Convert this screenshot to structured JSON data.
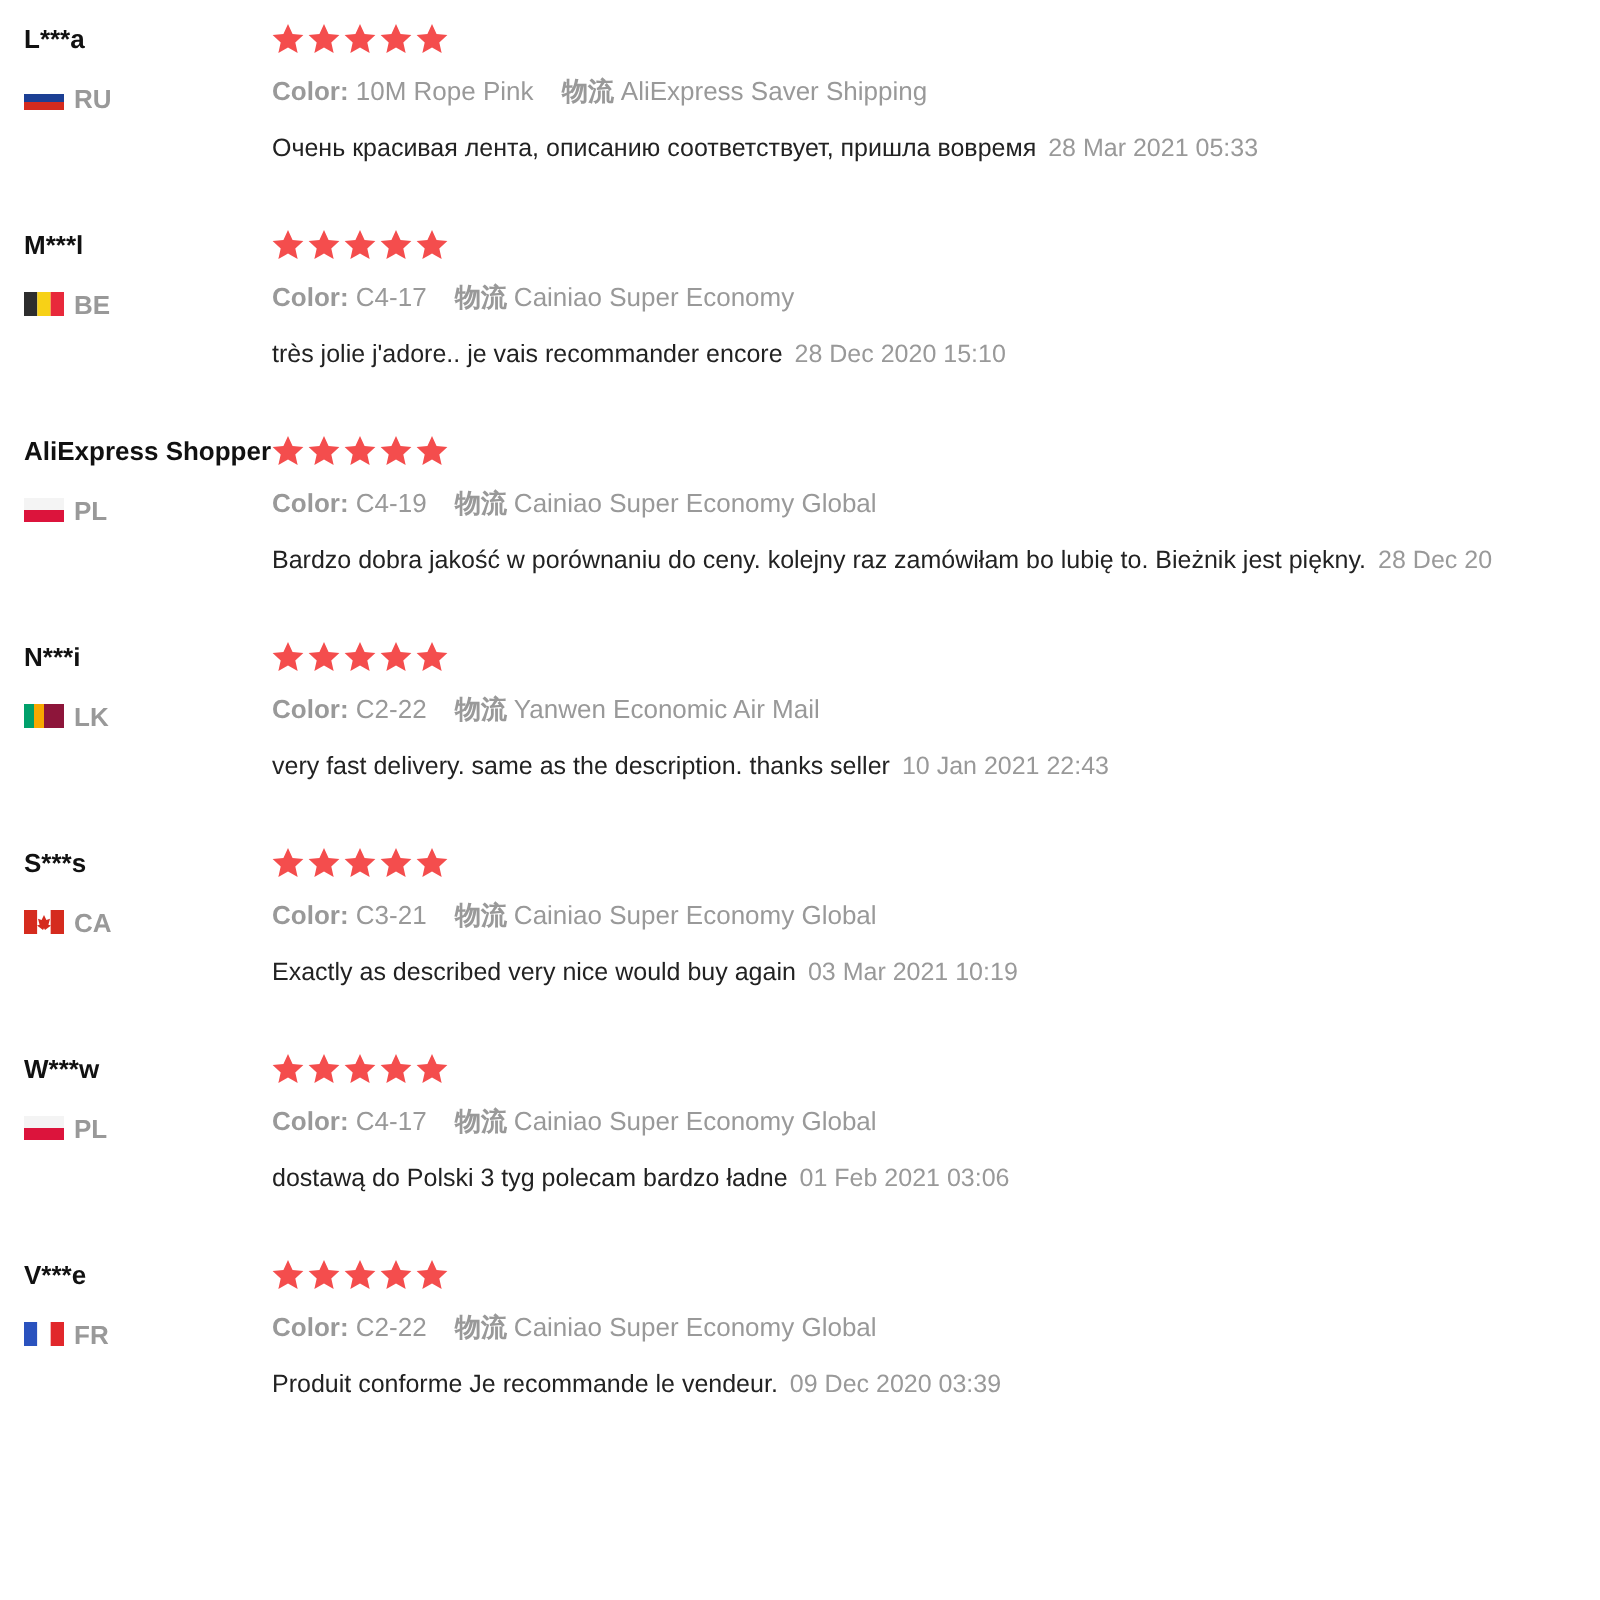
{
  "reviews": [
    {
      "name": "L***a",
      "country": "RU",
      "flag": {
        "kind": "russia"
      },
      "stars": 5,
      "color_label": "Color:",
      "color_option": "10M Rope Pink",
      "shipping_label": "物流",
      "shipping": "AliExpress Saver Shipping",
      "text": "Очень красивая лента, описанию соответствует, пришла вовремя",
      "date": "28 Mar 2021 05:33"
    },
    {
      "name": "M***l",
      "country": "BE",
      "flag": {
        "kind": "belgium"
      },
      "stars": 5,
      "color_label": "Color:",
      "color_option": "C4-17",
      "shipping_label": "物流",
      "shipping": "Cainiao Super Economy",
      "text": "très jolie j'adore.. je vais recommander encore",
      "date": "28 Dec 2020 15:10"
    },
    {
      "name": "AliExpress Shopper",
      "country": "PL",
      "flag": {
        "kind": "poland"
      },
      "stars": 5,
      "color_label": "Color:",
      "color_option": "C4-19",
      "shipping_label": "物流",
      "shipping": "Cainiao Super Economy Global",
      "text": "Bardzo dobra jakość w porównaniu do ceny. kolejny raz zamówiłam bo lubię to. Bieżnik jest piękny.",
      "date": "28 Dec 20"
    },
    {
      "name": "N***i",
      "country": "LK",
      "flag": {
        "kind": "srilanka"
      },
      "stars": 5,
      "color_label": "Color:",
      "color_option": "C2-22",
      "shipping_label": "物流",
      "shipping": "Yanwen Economic Air Mail",
      "text": "very fast delivery. same as the description. thanks seller",
      "date": "10 Jan 2021 22:43"
    },
    {
      "name": "S***s",
      "country": "CA",
      "flag": {
        "kind": "canada"
      },
      "stars": 5,
      "color_label": "Color:",
      "color_option": "C3-21",
      "shipping_label": "物流",
      "shipping": "Cainiao Super Economy Global",
      "text": "Exactly as described very nice would buy again",
      "date": "03 Mar 2021 10:19"
    },
    {
      "name": "W***w",
      "country": "PL",
      "flag": {
        "kind": "poland"
      },
      "stars": 5,
      "color_label": "Color:",
      "color_option": "C4-17",
      "shipping_label": "物流",
      "shipping": "Cainiao Super Economy Global",
      "text": "dostawą do Polski 3 tyg polecam bardzo ładne",
      "date": "01 Feb 2021 03:06"
    },
    {
      "name": "V***e",
      "country": "FR",
      "flag": {
        "kind": "france"
      },
      "stars": 5,
      "color_label": "Color:",
      "color_option": "C2-22",
      "shipping_label": "物流",
      "shipping": "Cainiao Super Economy Global",
      "text": "Produit conforme Je recommande le vendeur.",
      "date": "09 Dec 2020 03:39"
    }
  ]
}
